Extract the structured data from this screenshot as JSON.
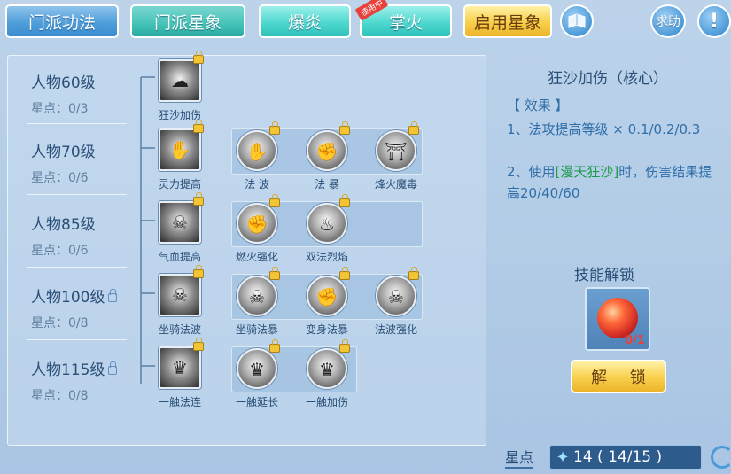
{
  "tabs": {
    "skills": "门派功法",
    "constellation": "门派星象",
    "baoyan": "爆炎",
    "zhanghuo": "掌火",
    "in_use_badge": "使用中",
    "enable": "启用星象",
    "help": "求助",
    "info": "!"
  },
  "levels": [
    {
      "name": "人物60级",
      "stars": "星点：0/3",
      "locked": false
    },
    {
      "name": "人物70级",
      "stars": "星点：0/6",
      "locked": false
    },
    {
      "name": "人物85级",
      "stars": "星点：0/6",
      "locked": false
    },
    {
      "name": "人物100级",
      "stars": "星点：0/8",
      "locked": true
    },
    {
      "name": "人物115级",
      "stars": "星点：0/8",
      "locked": true
    }
  ],
  "nodes": {
    "r1": [
      {
        "label": "狂沙加伤"
      }
    ],
    "r2": [
      {
        "label": "灵力提高"
      },
      {
        "label": "法 波"
      },
      {
        "label": "法 暴"
      },
      {
        "label": "烽火魔毒"
      }
    ],
    "r3": [
      {
        "label": "气血提高"
      },
      {
        "label": "燃火强化"
      },
      {
        "label": "双法烈焰"
      }
    ],
    "r4": [
      {
        "label": "坐骑法波"
      },
      {
        "label": "坐骑法暴"
      },
      {
        "label": "变身法暴"
      },
      {
        "label": "法波强化"
      }
    ],
    "r5": [
      {
        "label": "一触法连"
      },
      {
        "label": "一触延长"
      },
      {
        "label": "一触加伤"
      }
    ]
  },
  "detail": {
    "title": "狂沙加伤（核心）",
    "section": "【 效果 】",
    "line1": "1、法攻提高等级 × 0.1/0.2/0.3",
    "line2_a": "2、使用",
    "line2_hl": "[漫天狂沙]",
    "line2_b": "时，伤害结果提高20/40/60",
    "unlock_title": "技能解锁",
    "item_count": "0/1",
    "unlock_button": "解 锁"
  },
  "points": {
    "label": "星点",
    "value": "14 ( 14/15 )"
  },
  "colors": {
    "accent_blue": "#4f9fdb",
    "accent_cyan": "#43c3b8",
    "gold": "#f7cf4a",
    "highlight_green": "#1c9a49"
  }
}
